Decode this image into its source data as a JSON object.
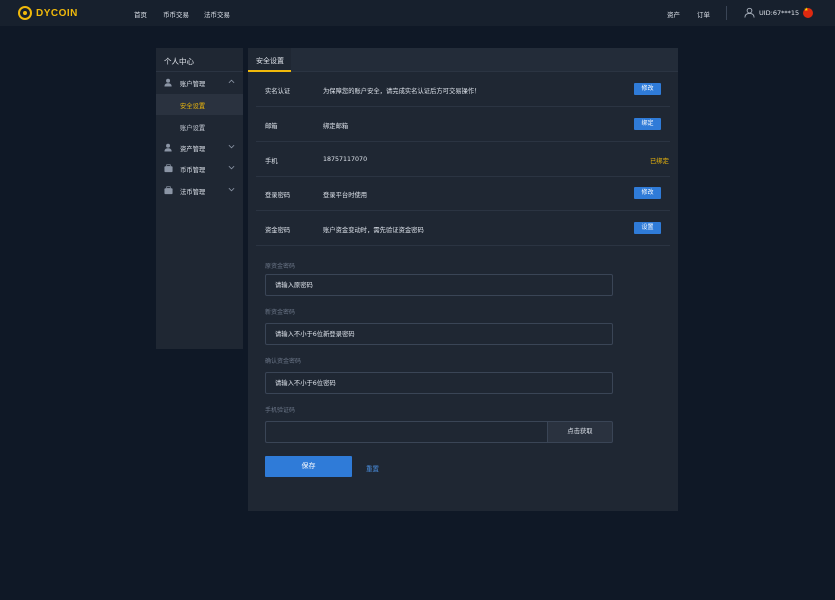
{
  "header": {
    "logo_text": "DYCOIN",
    "nav": [
      "首页",
      "币币交易",
      "法币交易"
    ],
    "right_nav": [
      "资产",
      "订单"
    ],
    "uid": "UID:67***15"
  },
  "sidebar": {
    "title": "个人中心",
    "sections": [
      {
        "label": "账户管理",
        "icon": "user-icon",
        "expanded": true,
        "children": [
          {
            "label": "安全设置",
            "active": true
          },
          {
            "label": "账户设置",
            "active": false
          }
        ]
      },
      {
        "label": "资产管理",
        "icon": "asset-icon",
        "expanded": false
      },
      {
        "label": "币币管理",
        "icon": "exchange-icon",
        "expanded": false
      },
      {
        "label": "法币管理",
        "icon": "fiat-icon",
        "expanded": false
      }
    ]
  },
  "main": {
    "tab": "安全设置",
    "rows": [
      {
        "name": "实名认证",
        "desc": "为保障您的账户安全，请完成实名认证后方可交易操作！",
        "action": "修改"
      },
      {
        "name": "邮箱",
        "desc": "绑定邮箱",
        "action": "绑定"
      },
      {
        "name": "手机",
        "desc": "18757117070",
        "status": "已绑定"
      },
      {
        "name": "登录密码",
        "desc": "登录平台时使用",
        "action": "修改"
      },
      {
        "name": "资金密码",
        "desc": "账户资金变动时，需先验证资金密码",
        "action": "设置"
      }
    ],
    "form": {
      "old_label": "原资金密码",
      "old_placeholder": "请输入原密码",
      "new_label": "新资金密码",
      "new_placeholder": "请输入不小于6位新登录密码",
      "confirm_label": "确认资金密码",
      "confirm_placeholder": "请输入不小于6位密码",
      "code_label": "手机验证码",
      "code_button": "点击获取",
      "save": "保存",
      "reset": "重置"
    }
  },
  "colors": {
    "accent": "#f0b90b",
    "primary": "#2f7bd8",
    "bg": "#0f1826",
    "panel": "#1f2733"
  }
}
